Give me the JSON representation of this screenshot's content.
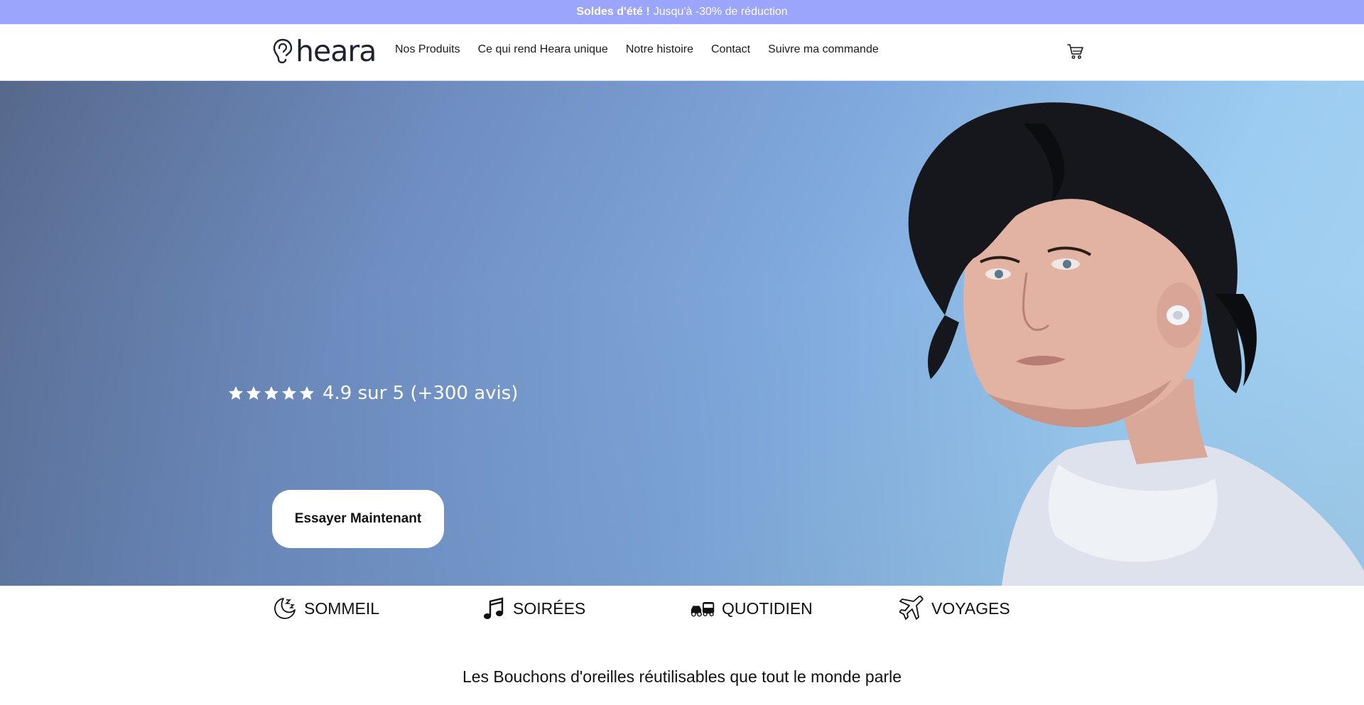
{
  "announcement": {
    "bold": "Soldes d'été !",
    "text": "Jusqu'à -30% de réduction"
  },
  "header": {
    "logo_text": "heara",
    "nav": [
      "Nos Produits",
      "Ce qui rend Heara unique",
      "Notre histoire",
      "Contact",
      "Suivre ma commande"
    ],
    "cart_icon": "cart-icon"
  },
  "hero": {
    "rating_stars": 5,
    "rating_text": "4.9 sur 5 (+300 avis)",
    "cta_label": "Essayer Maintenant"
  },
  "categories": [
    {
      "label": "SOMMEIL",
      "icon": "moon-sleep-icon"
    },
    {
      "label": "SOIRÉES",
      "icon": "music-notes-icon"
    },
    {
      "label": "QUOTIDIEN",
      "icon": "car-bus-icon"
    },
    {
      "label": "VOYAGES",
      "icon": "airplane-icon"
    }
  ],
  "tagline": "Les Bouchons d'oreilles réutilisables que tout le monde parle",
  "colors": {
    "announcement_bg": "#9aa5fb",
    "hero_bg": "#80a9dd"
  }
}
